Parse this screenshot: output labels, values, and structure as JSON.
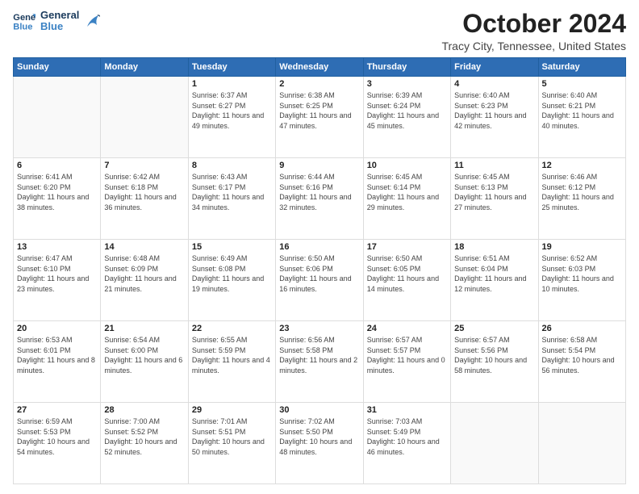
{
  "logo": {
    "line1": "General",
    "line2": "Blue"
  },
  "title": "October 2024",
  "subtitle": "Tracy City, Tennessee, United States",
  "days_header": [
    "Sunday",
    "Monday",
    "Tuesday",
    "Wednesday",
    "Thursday",
    "Friday",
    "Saturday"
  ],
  "weeks": [
    [
      {
        "day": "",
        "info": ""
      },
      {
        "day": "",
        "info": ""
      },
      {
        "day": "1",
        "sunrise": "6:37 AM",
        "sunset": "6:27 PM",
        "daylight": "11 hours and 49 minutes."
      },
      {
        "day": "2",
        "sunrise": "6:38 AM",
        "sunset": "6:25 PM",
        "daylight": "11 hours and 47 minutes."
      },
      {
        "day": "3",
        "sunrise": "6:39 AM",
        "sunset": "6:24 PM",
        "daylight": "11 hours and 45 minutes."
      },
      {
        "day": "4",
        "sunrise": "6:40 AM",
        "sunset": "6:23 PM",
        "daylight": "11 hours and 42 minutes."
      },
      {
        "day": "5",
        "sunrise": "6:40 AM",
        "sunset": "6:21 PM",
        "daylight": "11 hours and 40 minutes."
      }
    ],
    [
      {
        "day": "6",
        "sunrise": "6:41 AM",
        "sunset": "6:20 PM",
        "daylight": "11 hours and 38 minutes."
      },
      {
        "day": "7",
        "sunrise": "6:42 AM",
        "sunset": "6:18 PM",
        "daylight": "11 hours and 36 minutes."
      },
      {
        "day": "8",
        "sunrise": "6:43 AM",
        "sunset": "6:17 PM",
        "daylight": "11 hours and 34 minutes."
      },
      {
        "day": "9",
        "sunrise": "6:44 AM",
        "sunset": "6:16 PM",
        "daylight": "11 hours and 32 minutes."
      },
      {
        "day": "10",
        "sunrise": "6:45 AM",
        "sunset": "6:14 PM",
        "daylight": "11 hours and 29 minutes."
      },
      {
        "day": "11",
        "sunrise": "6:45 AM",
        "sunset": "6:13 PM",
        "daylight": "11 hours and 27 minutes."
      },
      {
        "day": "12",
        "sunrise": "6:46 AM",
        "sunset": "6:12 PM",
        "daylight": "11 hours and 25 minutes."
      }
    ],
    [
      {
        "day": "13",
        "sunrise": "6:47 AM",
        "sunset": "6:10 PM",
        "daylight": "11 hours and 23 minutes."
      },
      {
        "day": "14",
        "sunrise": "6:48 AM",
        "sunset": "6:09 PM",
        "daylight": "11 hours and 21 minutes."
      },
      {
        "day": "15",
        "sunrise": "6:49 AM",
        "sunset": "6:08 PM",
        "daylight": "11 hours and 19 minutes."
      },
      {
        "day": "16",
        "sunrise": "6:50 AM",
        "sunset": "6:06 PM",
        "daylight": "11 hours and 16 minutes."
      },
      {
        "day": "17",
        "sunrise": "6:50 AM",
        "sunset": "6:05 PM",
        "daylight": "11 hours and 14 minutes."
      },
      {
        "day": "18",
        "sunrise": "6:51 AM",
        "sunset": "6:04 PM",
        "daylight": "11 hours and 12 minutes."
      },
      {
        "day": "19",
        "sunrise": "6:52 AM",
        "sunset": "6:03 PM",
        "daylight": "11 hours and 10 minutes."
      }
    ],
    [
      {
        "day": "20",
        "sunrise": "6:53 AM",
        "sunset": "6:01 PM",
        "daylight": "11 hours and 8 minutes."
      },
      {
        "day": "21",
        "sunrise": "6:54 AM",
        "sunset": "6:00 PM",
        "daylight": "11 hours and 6 minutes."
      },
      {
        "day": "22",
        "sunrise": "6:55 AM",
        "sunset": "5:59 PM",
        "daylight": "11 hours and 4 minutes."
      },
      {
        "day": "23",
        "sunrise": "6:56 AM",
        "sunset": "5:58 PM",
        "daylight": "11 hours and 2 minutes."
      },
      {
        "day": "24",
        "sunrise": "6:57 AM",
        "sunset": "5:57 PM",
        "daylight": "11 hours and 0 minutes."
      },
      {
        "day": "25",
        "sunrise": "6:57 AM",
        "sunset": "5:56 PM",
        "daylight": "10 hours and 58 minutes."
      },
      {
        "day": "26",
        "sunrise": "6:58 AM",
        "sunset": "5:54 PM",
        "daylight": "10 hours and 56 minutes."
      }
    ],
    [
      {
        "day": "27",
        "sunrise": "6:59 AM",
        "sunset": "5:53 PM",
        "daylight": "10 hours and 54 minutes."
      },
      {
        "day": "28",
        "sunrise": "7:00 AM",
        "sunset": "5:52 PM",
        "daylight": "10 hours and 52 minutes."
      },
      {
        "day": "29",
        "sunrise": "7:01 AM",
        "sunset": "5:51 PM",
        "daylight": "10 hours and 50 minutes."
      },
      {
        "day": "30",
        "sunrise": "7:02 AM",
        "sunset": "5:50 PM",
        "daylight": "10 hours and 48 minutes."
      },
      {
        "day": "31",
        "sunrise": "7:03 AM",
        "sunset": "5:49 PM",
        "daylight": "10 hours and 46 minutes."
      },
      {
        "day": "",
        "info": ""
      },
      {
        "day": "",
        "info": ""
      }
    ]
  ]
}
